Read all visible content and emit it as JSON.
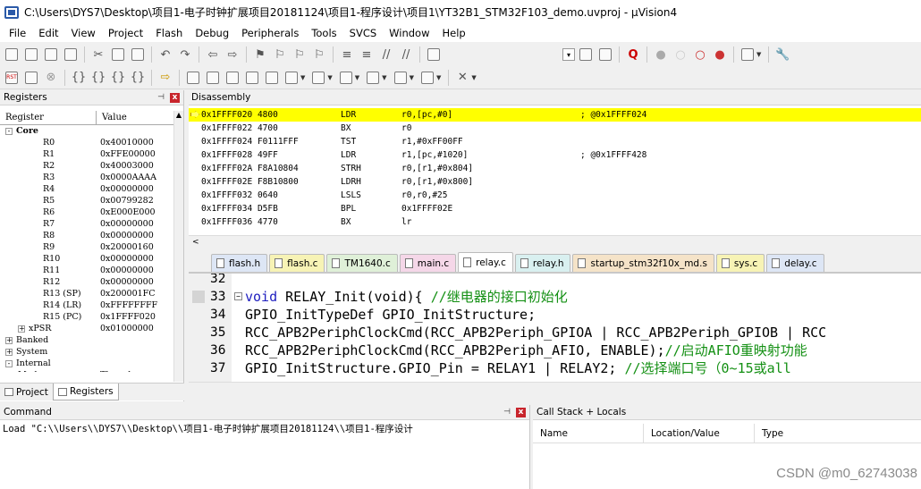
{
  "window": {
    "title": "C:\\Users\\DYS7\\Desktop\\项目1-电子时钟扩展项目20181124\\项目1-程序设计\\项目1\\YT32B1_STM32F103_demo.uvproj - µVision4"
  },
  "menu": [
    "File",
    "Edit",
    "View",
    "Project",
    "Flash",
    "Debug",
    "Peripherals",
    "Tools",
    "SVCS",
    "Window",
    "Help"
  ],
  "registers": {
    "title": "Registers",
    "col_register": "Register",
    "col_value": "Value",
    "rows": [
      {
        "name": "Core",
        "value": "",
        "level": 0,
        "expander": "-",
        "bold": true
      },
      {
        "name": "R0",
        "value": "0x40010000",
        "level": 2
      },
      {
        "name": "R1",
        "value": "0xFFE00000",
        "level": 2
      },
      {
        "name": "R2",
        "value": "0x40003000",
        "level": 2
      },
      {
        "name": "R3",
        "value": "0x0000AAAA",
        "level": 2
      },
      {
        "name": "R4",
        "value": "0x00000000",
        "level": 2
      },
      {
        "name": "R5",
        "value": "0x00799282",
        "level": 2
      },
      {
        "name": "R6",
        "value": "0xE000E000",
        "level": 2
      },
      {
        "name": "R7",
        "value": "0x00000000",
        "level": 2
      },
      {
        "name": "R8",
        "value": "0x00000000",
        "level": 2
      },
      {
        "name": "R9",
        "value": "0x20000160",
        "level": 2
      },
      {
        "name": "R10",
        "value": "0x00000000",
        "level": 2
      },
      {
        "name": "R11",
        "value": "0x00000000",
        "level": 2
      },
      {
        "name": "R12",
        "value": "0x00000000",
        "level": 2
      },
      {
        "name": "R13 (SP)",
        "value": "0x200001FC",
        "level": 2
      },
      {
        "name": "R14 (LR)",
        "value": "0xFFFFFFFF",
        "level": 2
      },
      {
        "name": "R15 (PC)",
        "value": "0x1FFFF020",
        "level": 2
      },
      {
        "name": "xPSR",
        "value": "0x01000000",
        "level": 1,
        "expander": "+"
      },
      {
        "name": "Banked",
        "value": "",
        "level": 0,
        "expander": "+"
      },
      {
        "name": "System",
        "value": "",
        "level": 0,
        "expander": "+"
      },
      {
        "name": "Internal",
        "value": "",
        "level": 0,
        "expander": "-"
      },
      {
        "name": "Mode",
        "value": "Thread",
        "level": 1
      }
    ],
    "tabs": [
      "Project",
      "Registers"
    ]
  },
  "disassembly": {
    "title": "Disassembly",
    "rows": [
      {
        "addr": "0x1FFFF020",
        "op": "4800",
        "mn": "LDR",
        "args": "r0,[pc,#0]",
        "cmt": "; @0x1FFFF024",
        "current": true
      },
      {
        "addr": "0x1FFFF022",
        "op": "4700",
        "mn": "BX",
        "args": "r0",
        "cmt": ""
      },
      {
        "addr": "0x1FFFF024",
        "op": "F0111FFF",
        "mn": "TST",
        "args": "r1,#0xFF00FF",
        "cmt": ""
      },
      {
        "addr": "0x1FFFF028",
        "op": "49FF",
        "mn": "LDR",
        "args": "r1,[pc,#1020]",
        "cmt": "; @0x1FFFF428"
      },
      {
        "addr": "0x1FFFF02A",
        "op": "F8A10804",
        "mn": "STRH",
        "args": "r0,[r1,#0x804]",
        "cmt": ""
      },
      {
        "addr": "0x1FFFF02E",
        "op": "F8B10800",
        "mn": "LDRH",
        "args": "r0,[r1,#0x800]",
        "cmt": ""
      },
      {
        "addr": "0x1FFFF032",
        "op": "0640",
        "mn": "LSLS",
        "args": "r0,r0,#25",
        "cmt": ""
      },
      {
        "addr": "0x1FFFF034",
        "op": "D5FB",
        "mn": "BPL",
        "args": "0x1FFFF02E",
        "cmt": ""
      },
      {
        "addr": "0x1FFFF036",
        "op": "4770",
        "mn": "BX",
        "args": "lr",
        "cmt": ""
      }
    ]
  },
  "file_tabs": [
    {
      "name": "flash.h",
      "color": "#dde6f5"
    },
    {
      "name": "flash.c",
      "color": "#f7f3b5"
    },
    {
      "name": "TM1640.c",
      "color": "#dff0d8"
    },
    {
      "name": "main.c",
      "color": "#f5d7e8"
    },
    {
      "name": "relay.c",
      "color": "#ffffff",
      "active": true
    },
    {
      "name": "relay.h",
      "color": "#d9f0f0"
    },
    {
      "name": "startup_stm32f10x_md.s",
      "color": "#f5e3c8"
    },
    {
      "name": "sys.c",
      "color": "#f7f3b5"
    },
    {
      "name": "delay.c",
      "color": "#dde6f5"
    }
  ],
  "editor": {
    "lines": [
      {
        "num": "32",
        "pre": "",
        "kw": "",
        "post": "",
        "cm": ""
      },
      {
        "num": "33",
        "pre": "",
        "kw": "void",
        "post": " RELAY_Init(void){ ",
        "cm": "//继电器的接口初始化"
      },
      {
        "num": "34",
        "pre": "  GPIO_InitTypeDef  GPIO_InitStructure;",
        "kw": "",
        "post": "",
        "cm": ""
      },
      {
        "num": "35",
        "pre": "  RCC_APB2PeriphClockCmd(RCC_APB2Periph_GPIOA | RCC_APB2Periph_GPIOB | RCC",
        "kw": "",
        "post": "",
        "cm": ""
      },
      {
        "num": "36",
        "pre": "  RCC_APB2PeriphClockCmd(RCC_APB2Periph_AFIO, ENABLE);",
        "kw": "",
        "post": "",
        "cm": "//启动AFIO重映射功能"
      },
      {
        "num": "37",
        "pre": "    GPIO_InitStructure.GPIO_Pin = RELAY1 | RELAY2; ",
        "kw": "",
        "post": "",
        "cm": "//选择端口号（0~15或all"
      }
    ]
  },
  "command": {
    "title": "Command",
    "text": "Load \"C:\\\\Users\\\\DYS7\\\\Desktop\\\\项目1-电子时钟扩展项目20181124\\\\项目1-程序设计"
  },
  "callstack": {
    "title": "Call Stack + Locals",
    "cols": [
      "Name",
      "Location/Value",
      "Type"
    ]
  },
  "watermark": "CSDN @m0_62743038"
}
